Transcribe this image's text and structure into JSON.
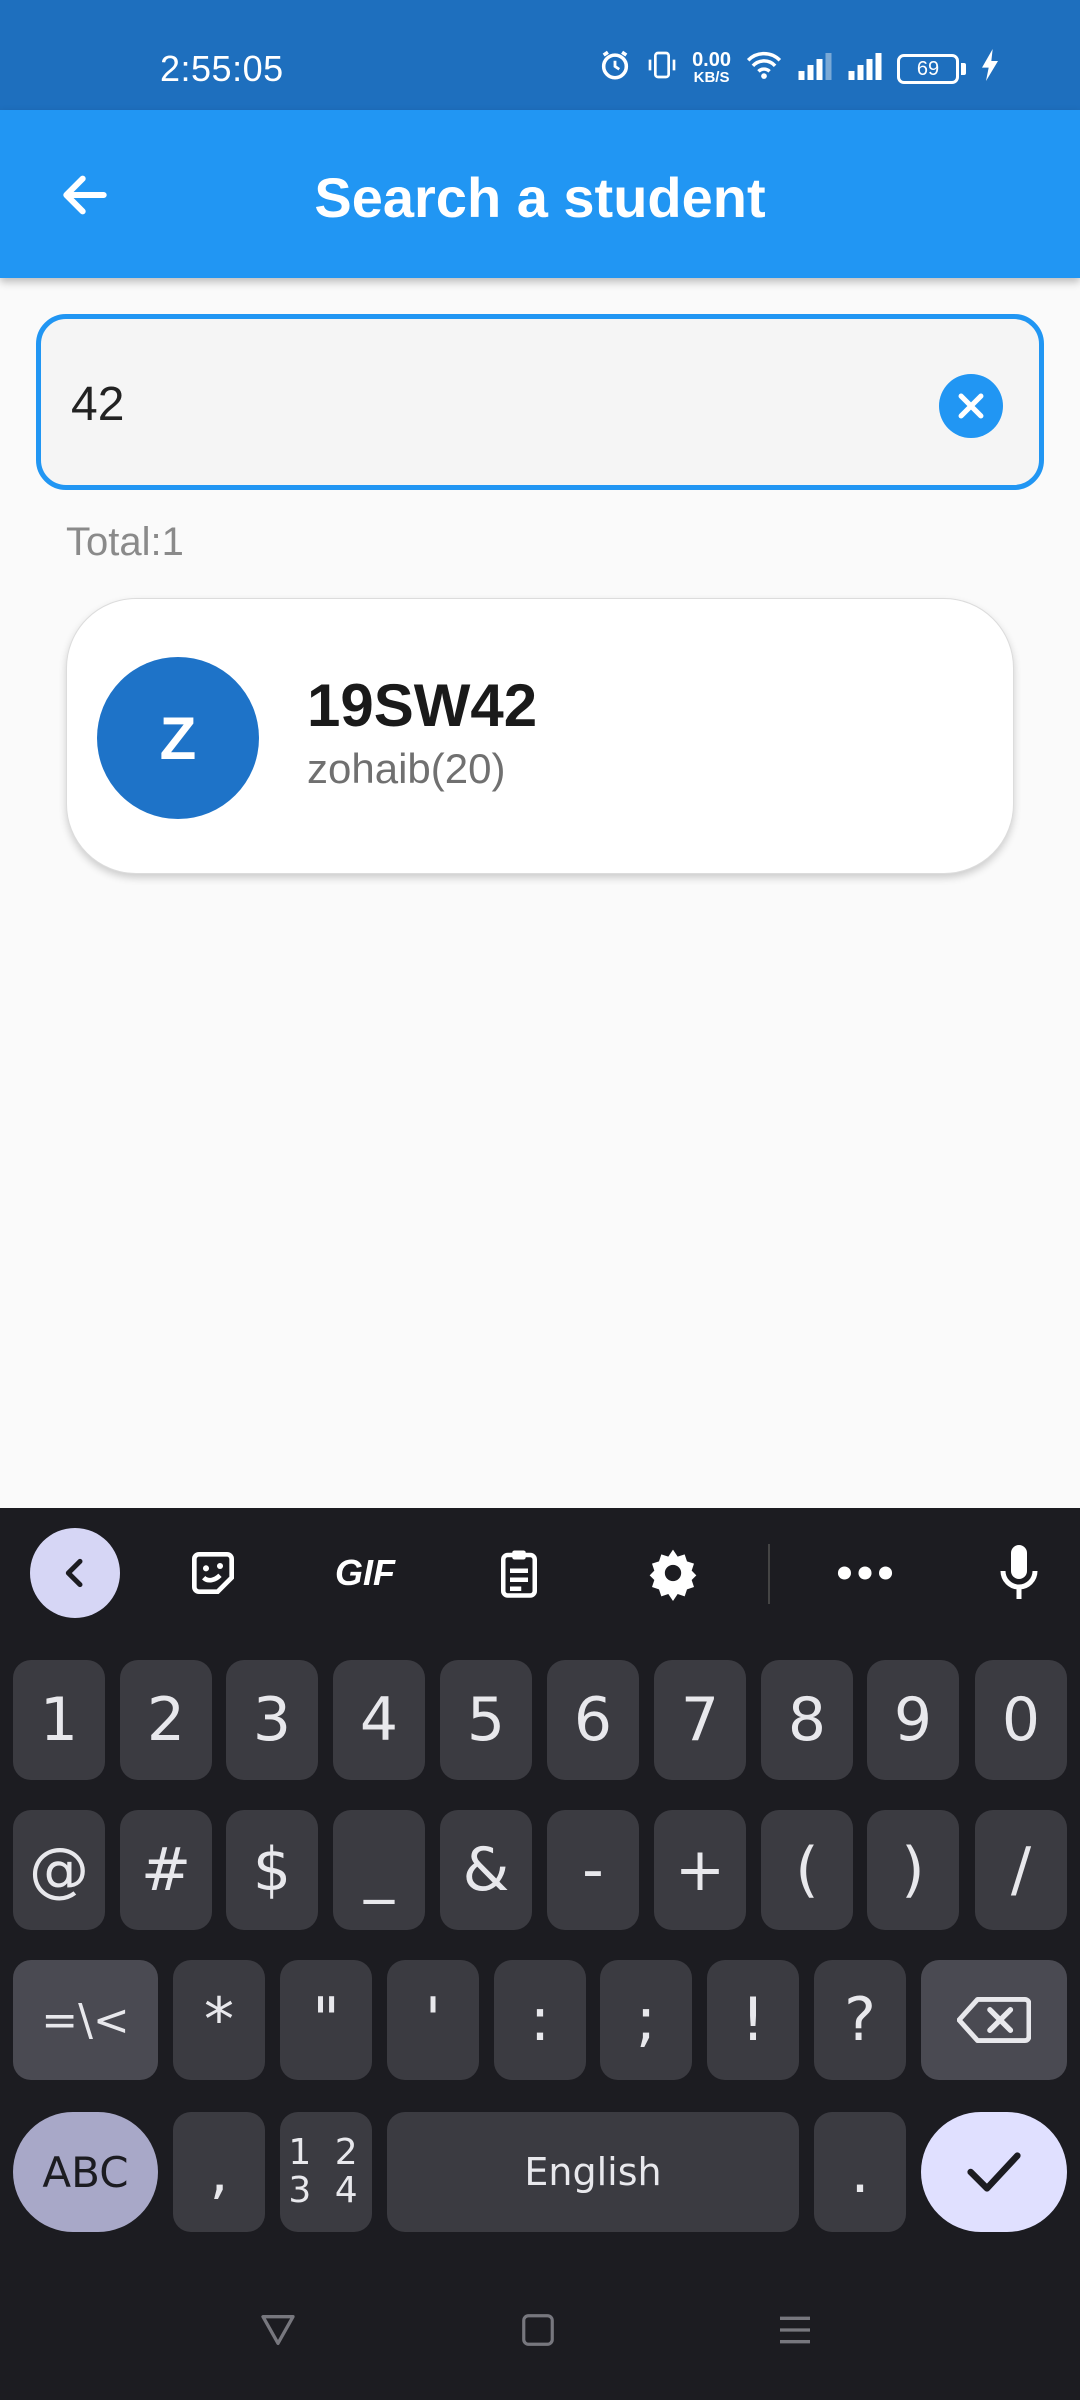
{
  "status": {
    "time": "2:55:05",
    "net_speed_value": "0.00",
    "net_speed_unit": "KB/S",
    "battery": "69"
  },
  "appbar": {
    "title": "Search a student"
  },
  "search": {
    "value": "42"
  },
  "results": {
    "total_label": "Total:1",
    "items": [
      {
        "initial": "Z",
        "roll_no": "19SW42",
        "name": "zohaib(20)"
      }
    ]
  },
  "keyboard": {
    "toolbar_gif": "GIF",
    "row1": [
      "1",
      "2",
      "3",
      "4",
      "5",
      "6",
      "7",
      "8",
      "9",
      "0"
    ],
    "row2": [
      "@",
      "#",
      "$",
      "_",
      "&",
      "-",
      "+",
      "(",
      ")",
      "/"
    ],
    "row3": [
      "=\\<",
      "*",
      "\"",
      "'",
      ":",
      ";",
      "!",
      "?"
    ],
    "abc": "ABC",
    "comma": ",",
    "numpad_top": "1 2",
    "numpad_bottom": "3 4",
    "space": "English",
    "period": "."
  },
  "colors": {
    "status_bar": "#1e6fbe",
    "app_bar": "#2196f3",
    "avatar": "#1e73c8",
    "keyboard_bg": "#1c1c21"
  }
}
